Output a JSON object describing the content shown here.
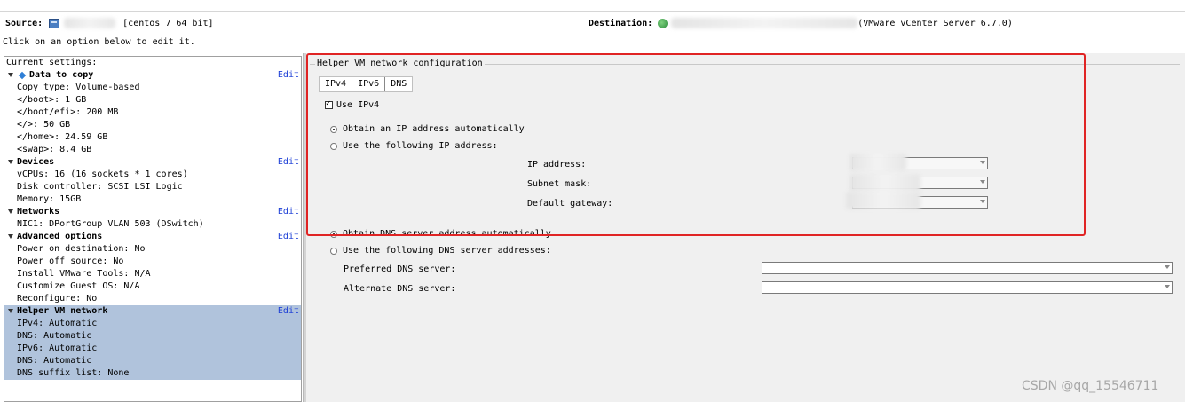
{
  "header": {
    "source_label": "Source:",
    "source_desc": "[centos 7 64 bit]",
    "destination_label": "Destination:",
    "destination_desc": "(VMware vCenter Server 6.7.0)",
    "hint": "Click on an option below to edit it."
  },
  "settings": {
    "title": "Current settings:",
    "edit_label": "Edit",
    "data_to_copy": {
      "title": "Data to copy",
      "items": [
        "Copy type: Volume-based",
        "</boot>: 1 GB",
        "</boot/efi>: 200 MB",
        "</>: 50 GB",
        "</home>: 24.59 GB",
        "<swap>: 8.4 GB"
      ]
    },
    "devices": {
      "title": "Devices",
      "items": [
        "vCPUs: 16 (16 sockets * 1 cores)",
        "Disk controller: SCSI LSI Logic",
        "Memory: 15GB"
      ]
    },
    "networks": {
      "title": "Networks",
      "items": [
        "NIC1: DPortGroup VLAN 503 (DSwitch)"
      ]
    },
    "advanced": {
      "title": "Advanced options",
      "items": [
        "Power on destination: No",
        "Power off source: No",
        "Install VMware Tools: N/A",
        "Customize Guest OS: N/A",
        "Reconfigure: No"
      ]
    },
    "helper": {
      "title": "Helper VM network",
      "items": [
        "IPv4: Automatic",
        "DNS: Automatic",
        "IPv6: Automatic",
        "DNS: Automatic",
        "DNS suffix list: None"
      ]
    }
  },
  "config": {
    "group_title": "Helper VM network configuration",
    "tabs": [
      "IPv4",
      "IPv6",
      "DNS"
    ],
    "use_ipv4": "Use IPv4",
    "obtain_ip_auto": "Obtain an IP address automatically",
    "use_following_ip": "Use the following IP address:",
    "ip_address": "IP address:",
    "subnet_mask": "Subnet mask:",
    "default_gateway": "Default gateway:",
    "obtain_dns_auto": "Obtain DNS server address automatically",
    "use_following_dns": "Use the following DNS server addresses:",
    "preferred_dns": "Preferred DNS server:",
    "alternate_dns": "Alternate DNS server:"
  },
  "watermark": "CSDN @qq_15546711",
  "colors": {
    "selection": "#b0c3dc",
    "edit_link": "#1d3fd6",
    "highlight_box": "#e02424"
  }
}
